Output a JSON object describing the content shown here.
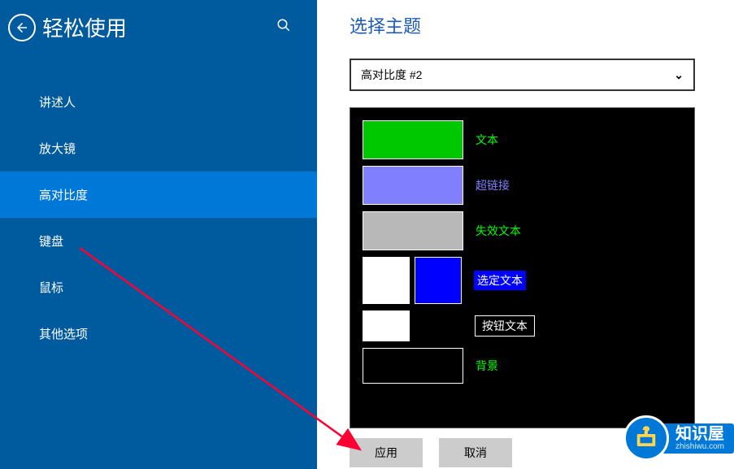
{
  "sidebar": {
    "title": "轻松使用",
    "items": [
      {
        "label": "讲述人",
        "active": false
      },
      {
        "label": "放大镜",
        "active": false
      },
      {
        "label": "高对比度",
        "active": true
      },
      {
        "label": "键盘",
        "active": false
      },
      {
        "label": "鼠标",
        "active": false
      },
      {
        "label": "其他选项",
        "active": false
      }
    ]
  },
  "main": {
    "title": "选择主题",
    "dropdown_value": "高对比度 #2",
    "color_rows": {
      "text": {
        "label": "文本",
        "color": "#00c800"
      },
      "hyperlink": {
        "label": "超链接",
        "color": "#8080ff"
      },
      "disabled_text": {
        "label": "失效文本",
        "color": "#b8b8b8"
      },
      "selected_text": {
        "label": "选定文本",
        "fg": "#ffffff",
        "bg": "#0000ff"
      },
      "button_text": {
        "label": "按钮文本",
        "fg": "#ffffff",
        "bg": "#000000"
      },
      "background": {
        "label": "背景",
        "color": "#000000"
      }
    },
    "apply_button": "应用",
    "cancel_button": "取消"
  },
  "watermark": {
    "title": "知识屋",
    "subtitle": "zhishiwu.com"
  }
}
